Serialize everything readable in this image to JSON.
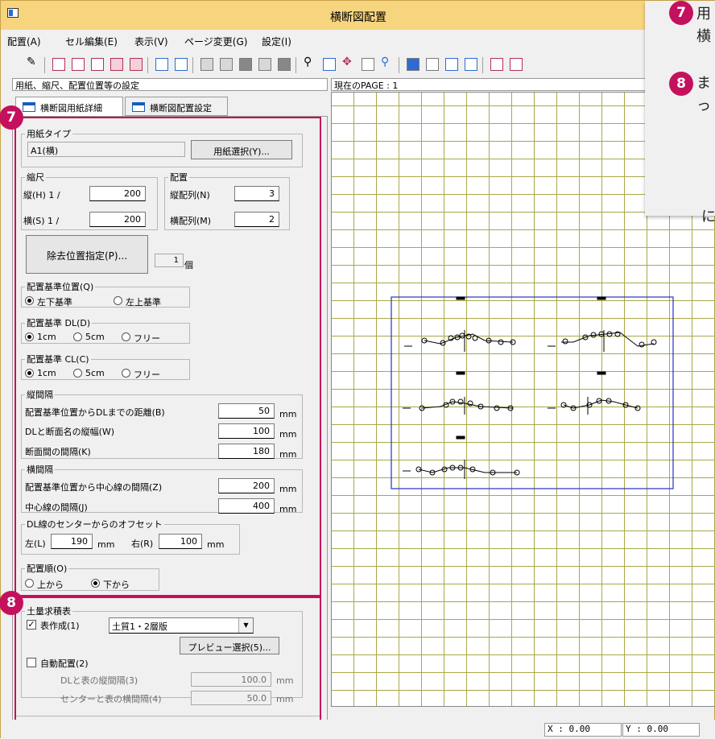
{
  "window": {
    "title": "横断図配置"
  },
  "menu": [
    "配置(A)",
    "セル編集(E)",
    "表示(V)",
    "ページ変更(G)",
    "設定(I)"
  ],
  "panel_title": "用紙、縮尺、配置位置等の設定",
  "page_title": "現在のPAGE : 1",
  "tabs": [
    "横断図用紙詳細",
    "横断図配置設定"
  ],
  "badges": {
    "b7": "7",
    "b8": "8"
  },
  "paper": {
    "legend": "用紙タイプ",
    "value": "A1(横)",
    "select_button": "用紙選択(Y)..."
  },
  "scale": {
    "legend": "縮尺",
    "v_label": "縦(H) 1 /",
    "v_value": "200",
    "h_label": "横(S) 1 /",
    "h_value": "200"
  },
  "layout": {
    "legend": "配置",
    "rows_label": "縦配列(N)",
    "rows_value": "3",
    "cols_label": "横配列(M)",
    "cols_value": "2"
  },
  "removal": {
    "button": "除去位置指定(P)...",
    "count": "1",
    "unit": "個"
  },
  "ref_pos": {
    "legend": "配置基準位置(Q)",
    "opt1": "左下基準",
    "opt2": "左上基準"
  },
  "dl": {
    "legend": "配置基準 DL(D)",
    "opt1": "1cm",
    "opt2": "5cm",
    "opt3": "フリー"
  },
  "cl": {
    "legend": "配置基準 CL(C)",
    "opt1": "1cm",
    "opt2": "5cm",
    "opt3": "フリー"
  },
  "vspace": {
    "legend": "縦間隔",
    "r1_label": "配置基準位置からDLまでの距離(B)",
    "r1_value": "50",
    "r2_label": "DLと断面名の縦幅(W)",
    "r2_value": "100",
    "r3_label": "断面間の間隔(K)",
    "r3_value": "180",
    "unit": "mm"
  },
  "hspace": {
    "legend": "横間隔",
    "r1_label": "配置基準位置から中心線の間隔(Z)",
    "r1_value": "200",
    "r2_label": "中心線の間隔(J)",
    "r2_value": "400",
    "unit": "mm"
  },
  "offset": {
    "legend": "DL線のセンターからのオフセット",
    "left_label": "左(L)",
    "left_value": "190",
    "right_label": "右(R)",
    "right_value": "100",
    "unit": "mm"
  },
  "order": {
    "legend": "配置順(O)",
    "opt1": "上から",
    "opt2": "下から"
  },
  "soil": {
    "legend": "土量求積表",
    "create_label": "表作成(1)",
    "create_check": "✓",
    "type_value": "土質1・2層版",
    "preview_button": "プレビュー選択(5)...",
    "auto_label": "自動配置(2)",
    "dl_gap_label": "DLと表の縦間隔(3)",
    "dl_gap_value": "100.0",
    "center_gap_label": "センターと表の横間隔(4)",
    "center_gap_value": "50.0",
    "unit": "mm"
  },
  "callout": {
    "n7": "7",
    "n8": "8",
    "t7a": "用",
    "t7b": "横",
    "t8a": "ま",
    "t8b": "っ",
    "t8c": "に"
  },
  "status": {
    "x": "X : 0.00",
    "y": "Y : 0.00"
  },
  "colors": {
    "accent": "#c4115d",
    "title_bg": "#f7d57f",
    "frame_blue": "#2430c8",
    "grid": "#a8a84a"
  }
}
